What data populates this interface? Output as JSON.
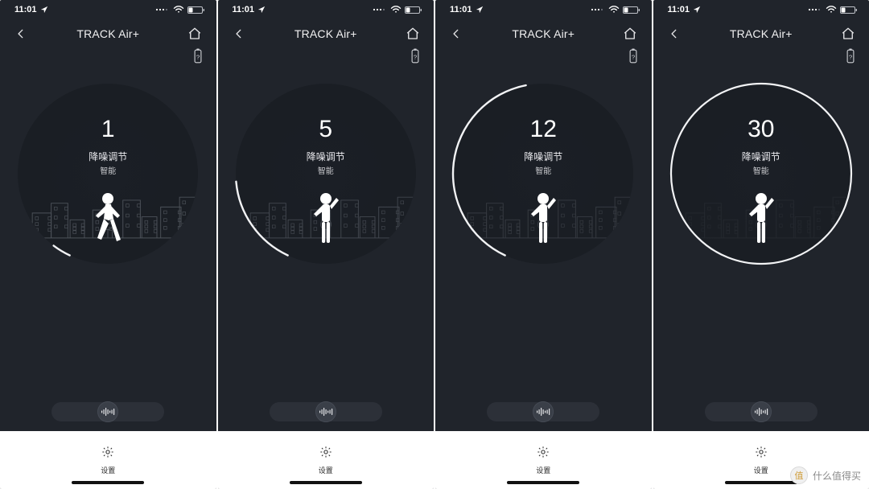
{
  "statusbar": {
    "time": "11:01"
  },
  "header": {
    "title": "TRACK Air+"
  },
  "labels": {
    "nc": "降噪调节",
    "mode": "智能",
    "settings": "设置"
  },
  "max_level": 30,
  "screens": [
    {
      "level": "1",
      "level_num": 1,
      "city_opacity": 0.4,
      "person": "walk"
    },
    {
      "level": "5",
      "level_num": 5,
      "city_opacity": 0.32,
      "person": "stand"
    },
    {
      "level": "12",
      "level_num": 12,
      "city_opacity": 0.22,
      "person": "stand"
    },
    {
      "level": "30",
      "level_num": 30,
      "city_opacity": 0.08,
      "person": "stand"
    }
  ],
  "watermark": {
    "text": "什么值得买",
    "badge": "值"
  }
}
